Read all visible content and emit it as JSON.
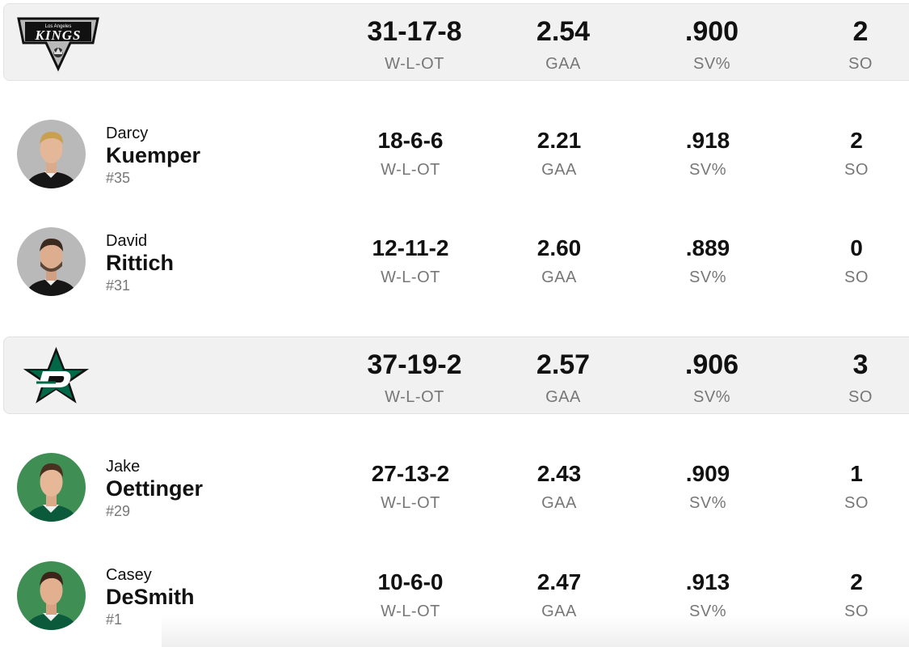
{
  "teams": [
    {
      "logo_icon": "la-kings-logo",
      "logo_text": "KINGS",
      "logo_subtext": "Los Angeles",
      "stats": [
        {
          "value": "31-17-8",
          "label": "W-L-OT"
        },
        {
          "value": "2.54",
          "label": "GAA"
        },
        {
          "value": ".900",
          "label": "SV%"
        },
        {
          "value": "2",
          "label": "SO"
        }
      ],
      "players": [
        {
          "first": "Darcy",
          "last": "Kuemper",
          "number": "#35",
          "stats": [
            {
              "value": "18-6-6",
              "label": "W-L-OT"
            },
            {
              "value": "2.21",
              "label": "GAA"
            },
            {
              "value": ".918",
              "label": "SV%"
            },
            {
              "value": "2",
              "label": "SO"
            }
          ]
        },
        {
          "first": "David",
          "last": "Rittich",
          "number": "#31",
          "stats": [
            {
              "value": "12-11-2",
              "label": "W-L-OT"
            },
            {
              "value": "2.60",
              "label": "GAA"
            },
            {
              "value": ".889",
              "label": "SV%"
            },
            {
              "value": "0",
              "label": "SO"
            }
          ]
        }
      ]
    },
    {
      "logo_icon": "dallas-stars-logo",
      "stats": [
        {
          "value": "37-19-2",
          "label": "W-L-OT"
        },
        {
          "value": "2.57",
          "label": "GAA"
        },
        {
          "value": ".906",
          "label": "SV%"
        },
        {
          "value": "3",
          "label": "SO"
        }
      ],
      "players": [
        {
          "first": "Jake",
          "last": "Oettinger",
          "number": "#29",
          "stats": [
            {
              "value": "27-13-2",
              "label": "W-L-OT"
            },
            {
              "value": "2.43",
              "label": "GAA"
            },
            {
              "value": ".909",
              "label": "SV%"
            },
            {
              "value": "1",
              "label": "SO"
            }
          ]
        },
        {
          "first": "Casey",
          "last": "DeSmith",
          "number": "#1",
          "stats": [
            {
              "value": "10-6-0",
              "label": "W-L-OT"
            },
            {
              "value": "2.47",
              "label": "GAA"
            },
            {
              "value": ".913",
              "label": "SV%"
            },
            {
              "value": "2",
              "label": "SO"
            }
          ]
        }
      ]
    }
  ],
  "colors": {
    "kings_avatar_bg": "#b9b9b9",
    "stars_avatar_bg": "#3f8f55",
    "stars_green": "#006847"
  }
}
